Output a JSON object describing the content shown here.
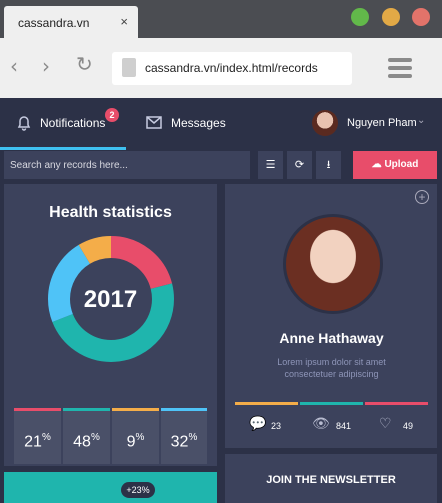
{
  "browser": {
    "tab_title": "cassandra.vn",
    "tab_close": "×",
    "url": "cassandra.vn/index.html/records",
    "window_buttons": {
      "green": "#62b84a",
      "yellow": "#e2a946",
      "red": "#e2736a"
    }
  },
  "nav": {
    "notifications_label": "Notifications",
    "notifications_badge": "2",
    "messages_label": "Messages",
    "user_name": "Nguyen Pham"
  },
  "search": {
    "placeholder": "Search any records here...",
    "upload_label": "Upload"
  },
  "health": {
    "title": "Health statistics",
    "year": "2017",
    "stats": [
      {
        "value": "21",
        "color": "#e84d6a"
      },
      {
        "value": "48",
        "color": "#1fb5ad"
      },
      {
        "value": "9",
        "color": "#f4ad49"
      },
      {
        "value": "32",
        "color": "#4fc3f7"
      }
    ],
    "percent_sign": "%"
  },
  "profile": {
    "name": "Anne Hathaway",
    "description": "Lorem ipsum dolor sit amet consectetuer adipiscing",
    "comments": "23",
    "views": "841",
    "likes": "49"
  },
  "growth": {
    "badge": "+23%"
  },
  "newsletter": {
    "title": "JOIN THE NEWSLETTER"
  },
  "colors": {
    "bg": "#2c3147",
    "card": "#3c425c",
    "accent": "#3fc0f0",
    "pink": "#e84d6a",
    "teal": "#1fb5ad",
    "orange": "#f4ad49",
    "blue": "#4fc3f7"
  }
}
